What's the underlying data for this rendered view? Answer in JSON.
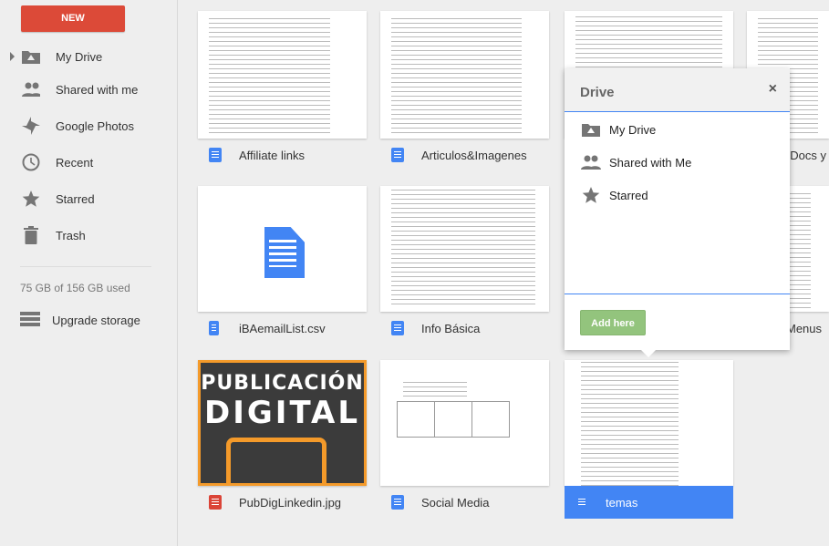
{
  "sidebar": {
    "new_label": "NEW",
    "items": [
      {
        "label": "My Drive",
        "icon": "drive-folder-icon"
      },
      {
        "label": "Shared with me",
        "icon": "people-icon"
      },
      {
        "label": "Google Photos",
        "icon": "pinwheel-icon"
      },
      {
        "label": "Recent",
        "icon": "clock-icon"
      },
      {
        "label": "Starred",
        "icon": "star-icon"
      },
      {
        "label": "Trash",
        "icon": "trash-icon"
      }
    ],
    "storage": "75 GB of 156 GB used",
    "upgrade": "Upgrade storage"
  },
  "files": [
    {
      "name": "Affiliate links",
      "type": "doc"
    },
    {
      "name": "Articulos&Imagenes",
      "type": "doc"
    },
    {
      "name": "",
      "type": "sheet"
    },
    {
      "name": "gDocs y",
      "type": "doc"
    },
    {
      "name": "iBAemailList.csv",
      "type": "csv"
    },
    {
      "name": "Info Básica",
      "type": "doc"
    },
    {
      "name": "Menus",
      "type": "doc"
    },
    {
      "name": "PubDigLinkedin.jpg",
      "type": "image",
      "thumb_text": [
        "PUBLICACIÓN",
        "DIGITAL"
      ]
    },
    {
      "name": "Social Media",
      "type": "doc"
    },
    {
      "name": "temas",
      "type": "doc",
      "selected": true
    }
  ],
  "popup": {
    "title": "Drive",
    "close": "×",
    "items": [
      {
        "label": "My Drive",
        "icon": "drive-folder-icon"
      },
      {
        "label": "Shared with Me",
        "icon": "people-icon"
      },
      {
        "label": "Starred",
        "icon": "star-icon"
      }
    ],
    "add_label": "Add here"
  },
  "colors": {
    "new": "#dc4a38",
    "accent": "#4285f4",
    "add": "#93c47d",
    "image_icon": "#db4437"
  }
}
